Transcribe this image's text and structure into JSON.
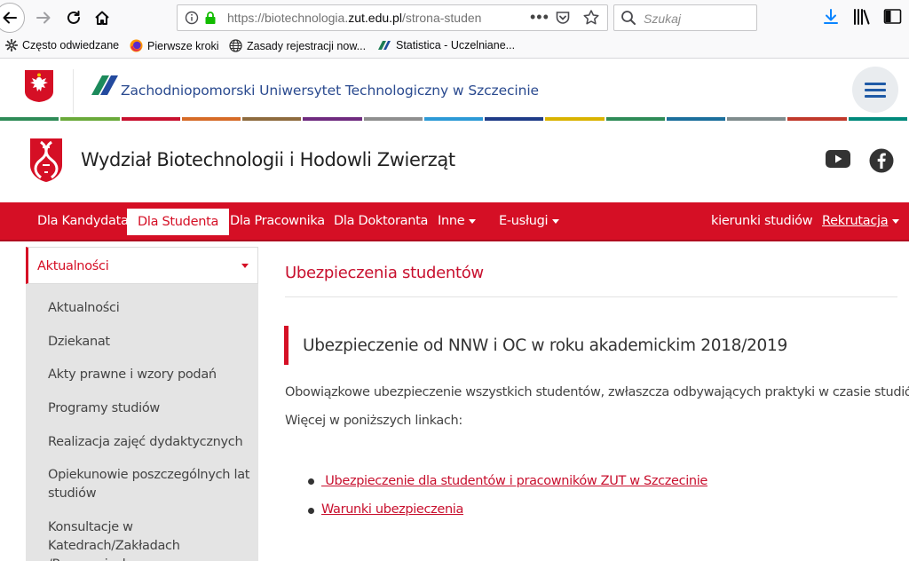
{
  "browser": {
    "url_prefix": "https://biotechnologia.",
    "url_domain": "zut.edu.pl",
    "url_path": "/strona-studen",
    "search_placeholder": "Szukaj",
    "bookmarks": [
      {
        "label": "Często odwiedzane",
        "icon": "gear-icon"
      },
      {
        "label": "Pierwsze kroki",
        "icon": "firefox-icon"
      },
      {
        "label": "Zasady rejestracji now...",
        "icon": "globe-icon"
      },
      {
        "label": "Statistica - Uczelniane...",
        "icon": "statistica-icon"
      }
    ]
  },
  "header": {
    "university_name": "Zachodniopomorski Uniwersytet Technologiczny w Szczecinie",
    "faculty_name": "Wydział Biotechnologii i Hodowli Zwierząt",
    "stripe_colors": [
      "#2e8b57",
      "#6aaa3a",
      "#c8102e",
      "#d66b27",
      "#8e6b3e",
      "#6f2b7f",
      "#8f8f8f",
      "#2d9ad6",
      "#1f3c88",
      "#d9b300",
      "#2e8b57",
      "#1c6f9c",
      "#7f8c8d",
      "#c0392b",
      "#00897b"
    ]
  },
  "nav": {
    "items": [
      {
        "label": "Dla Kandydata"
      },
      {
        "label": "Dla Studenta"
      },
      {
        "label": "Dla Pracownika"
      },
      {
        "label": "Dla Doktoranta"
      },
      {
        "label": "Inne"
      },
      {
        "label": "E-usługi"
      },
      {
        "label": "kierunki studiów"
      },
      {
        "label": "Rekrutacja"
      }
    ],
    "accent_color": "#d50f25"
  },
  "sidebar": {
    "header": "Aktualności",
    "items": [
      {
        "label": "Aktualności"
      },
      {
        "label": "Dziekanat"
      },
      {
        "label": "Akty prawne i wzory podań"
      },
      {
        "label": "Programy studiów"
      },
      {
        "label": "Realizacja zajęć dydaktycznych"
      },
      {
        "label": "Opiekunowie poszczególnych lat studiów"
      },
      {
        "label": "Konsultacje w Katedrach/Zakładach /Pracowniach"
      }
    ]
  },
  "main": {
    "page_title": "Ubezpieczenia studentów",
    "article_title": "Ubezpieczenie od NNW i OC w roku akademickim 2018/2019",
    "paragraph1": "Obowiązkowe ubezpieczenie wszystkich studentów, zwłaszcza odbywających praktyki w czasie studiów.",
    "paragraph2": "Więcej w poniższych linkach:",
    "links": [
      {
        "label": " Ubezpieczenie dla studentów i pracowników ZUT w Szczecinie"
      },
      {
        "label": "Warunki ubezpieczenia"
      }
    ]
  }
}
